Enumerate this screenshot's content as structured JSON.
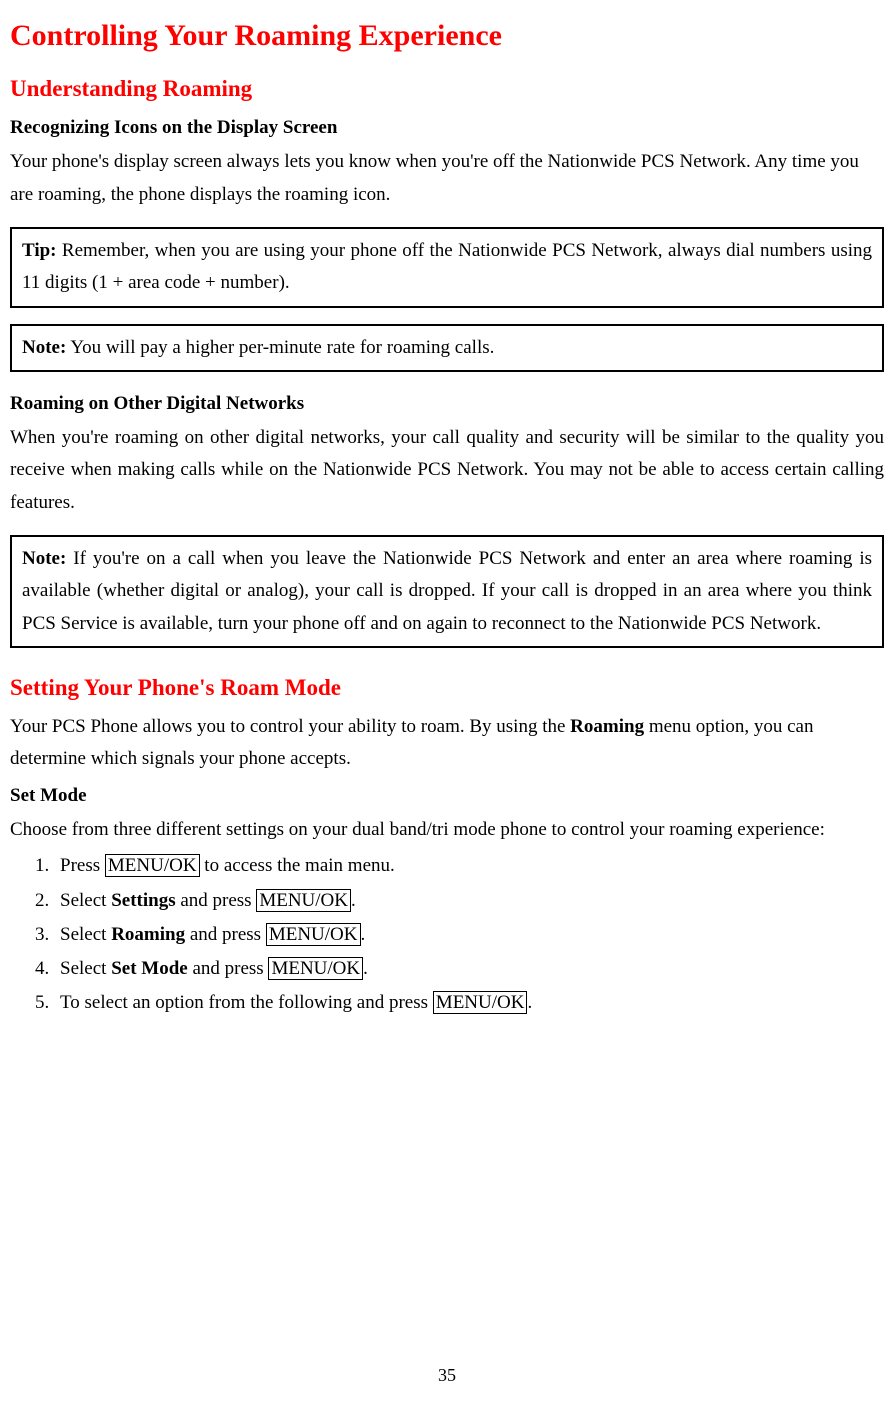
{
  "title": "Controlling Your Roaming Experience",
  "section1": {
    "heading": "Understanding Roaming",
    "sub1_heading": "Recognizing Icons on the Display Screen",
    "sub1_para": "Your phone's display screen always lets you know when you're off the Nationwide PCS Network. Any time you are roaming, the phone displays the roaming icon.",
    "tip_label": "Tip:",
    "tip_text": " Remember, when you are using your phone off the Nationwide PCS Network, always dial numbers using 11 digits (1 + area code + number).",
    "note1_label": "Note:",
    "note1_text": " You will pay a higher per-minute rate for roaming calls.",
    "sub2_heading": "Roaming on Other Digital Networks",
    "sub2_para": "When you're roaming on other digital networks, your call quality and security will be similar to the quality you receive when making calls while on the Nationwide PCS Network. You may not be able to access certain calling features.",
    "note2_label": "Note:",
    "note2_text": " If you're on a call when you leave the Nationwide PCS Network and enter an area where roaming is available (whether digital or analog), your call is dropped. If your call is dropped in an area where you think PCS Service is available, turn your phone off and on again to reconnect to the Nationwide PCS Network."
  },
  "section2": {
    "heading": "Setting Your Phone's Roam Mode",
    "para_pre": "Your PCS Phone allows you to control your ability to roam. By using the ",
    "para_bold": "Roaming",
    "para_post": " menu option, you can determine which signals your phone accepts.",
    "sub_heading": "Set Mode",
    "sub_para": "Choose from three different settings on your dual band/tri mode phone to control your roaming experience:",
    "steps": {
      "s1_pre": "Press ",
      "s1_key": "MENU/OK",
      "s1_post": " to access the main menu.",
      "s2_pre": "Select ",
      "s2_bold": "Settings",
      "s2_mid": " and press ",
      "s2_key": "MENU/OK",
      "s2_post": ".",
      "s3_pre": "Select ",
      "s3_bold": "Roaming",
      "s3_mid": " and press ",
      "s3_key": "MENU/OK",
      "s3_post": ".",
      "s4_pre": "Select ",
      "s4_bold": "Set Mode",
      "s4_mid": " and press ",
      "s4_key": "MENU/OK",
      "s4_post": ".",
      "s5_pre": "To select an option from the following and press ",
      "s5_key": "MENU/OK",
      "s5_post": "."
    }
  },
  "page_number": "35"
}
